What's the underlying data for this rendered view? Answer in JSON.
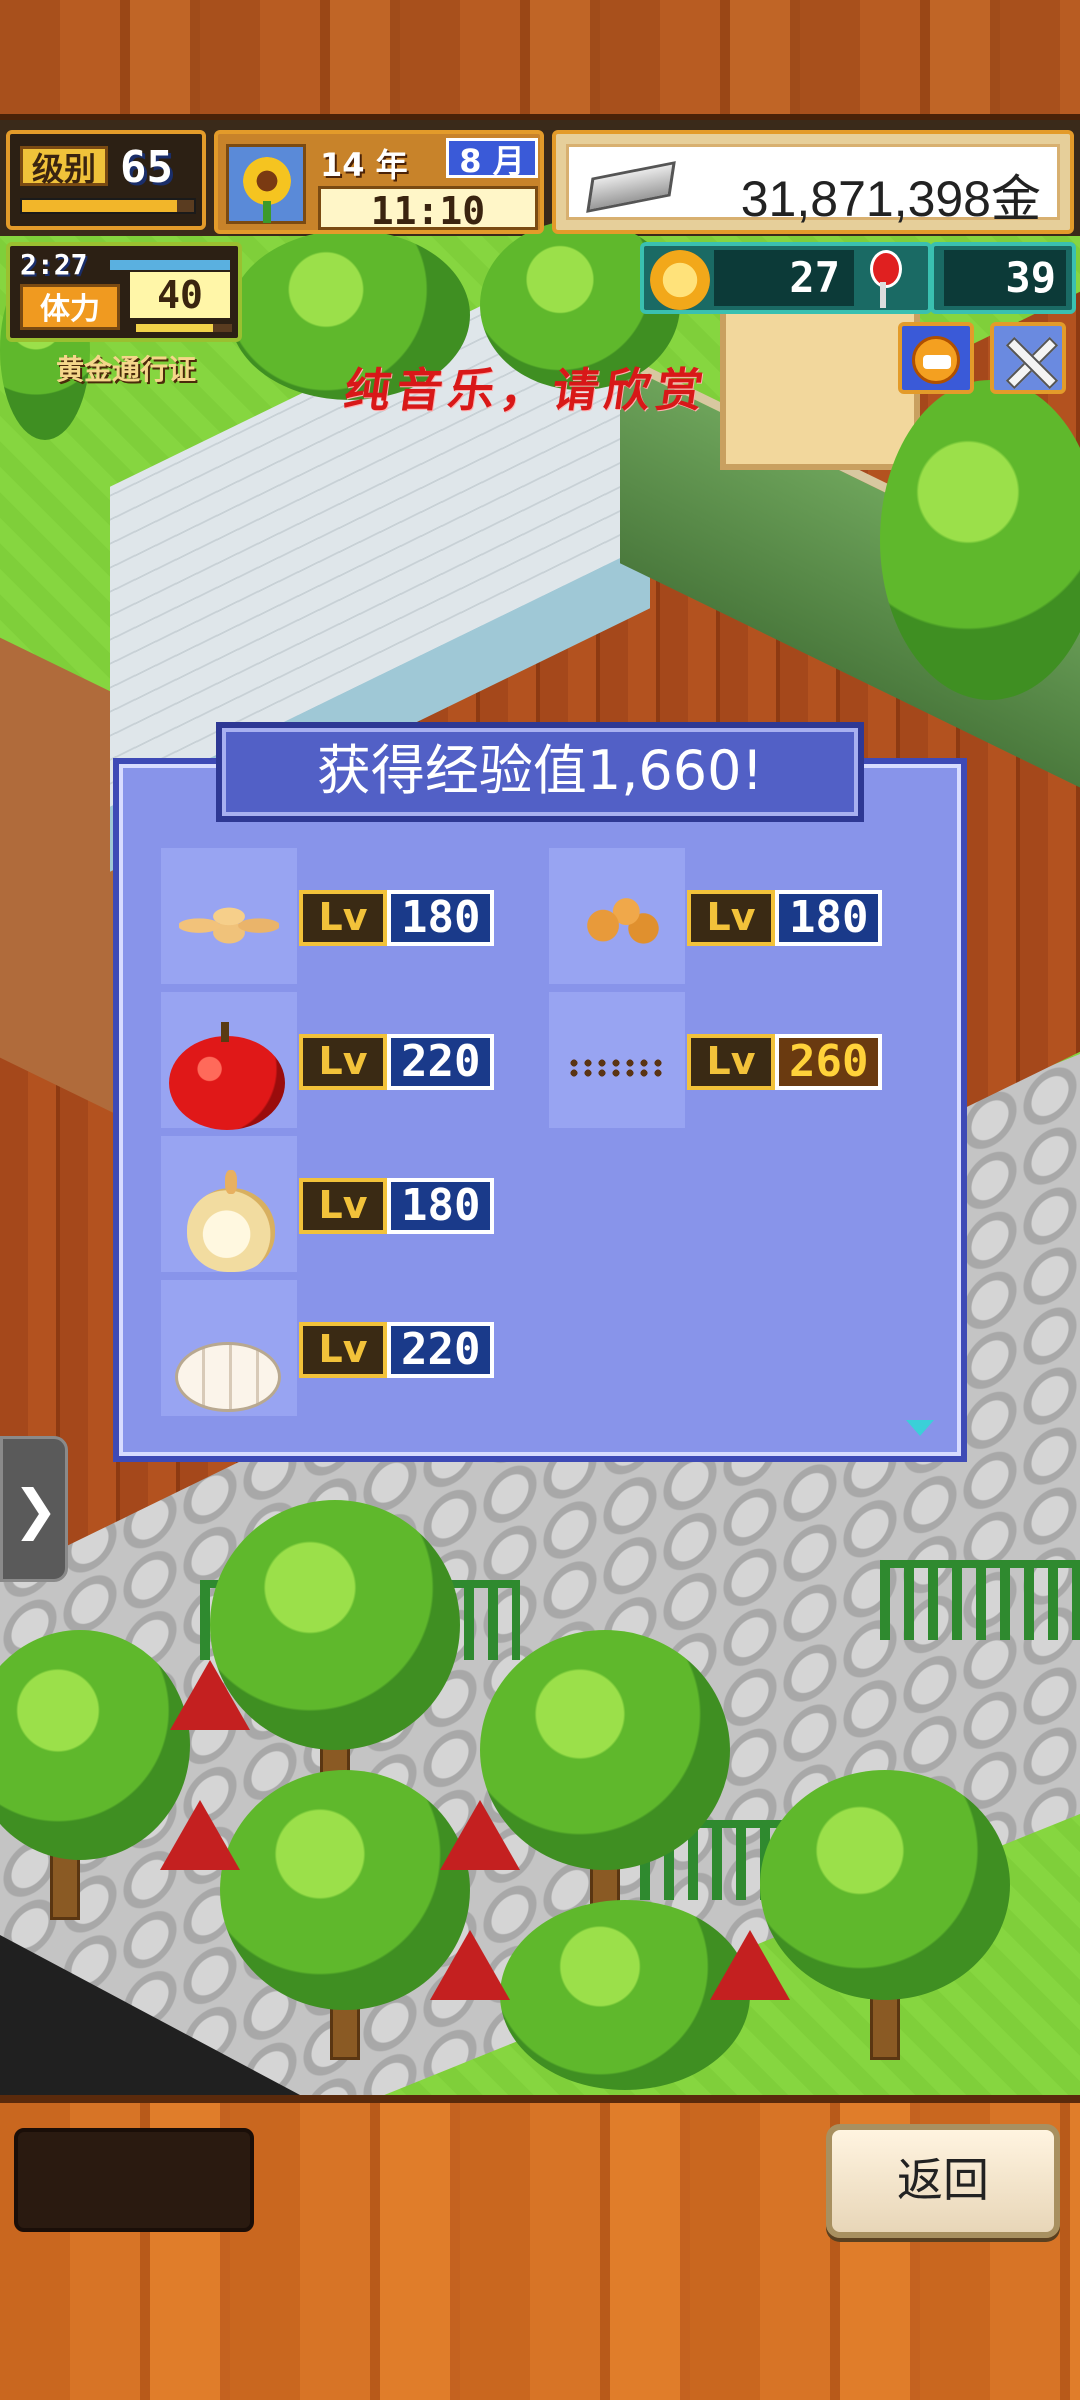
{
  "hud": {
    "level_label": "级别",
    "level_value": "65",
    "level_progress": 0.9,
    "date_year": "14 年",
    "date_month": "8 月",
    "date_time": "11:10",
    "money": "31,871,398金",
    "stamina_timer": "2:27",
    "stamina_label": "体力",
    "stamina_value": "40",
    "stamina_progress": 0.8,
    "pass_label": "黄金通行证",
    "coins": "27",
    "tickets": "39"
  },
  "ticker_text": "纯音乐，请欣赏",
  "dialog": {
    "title": "获得经验值1,660!",
    "lv_badge": "Lv",
    "items": [
      {
        "icon": "cookies-icon",
        "level": "180"
      },
      {
        "icon": "nuggets-icon",
        "level": "180"
      },
      {
        "icon": "apple-icon",
        "level": "220"
      },
      {
        "icon": "seeds-icon",
        "level": "260"
      },
      {
        "icon": "onion-icon",
        "level": "180"
      },
      {
        "icon": "garlic-icon",
        "level": "220"
      }
    ]
  },
  "footer": {
    "back_label": "返回"
  },
  "colors": {
    "dialog_bg": "#8894ea",
    "dialog_title_bg": "#5260c6",
    "level_blue": "#1a3a8a",
    "level_gold": "#6a3a10"
  }
}
